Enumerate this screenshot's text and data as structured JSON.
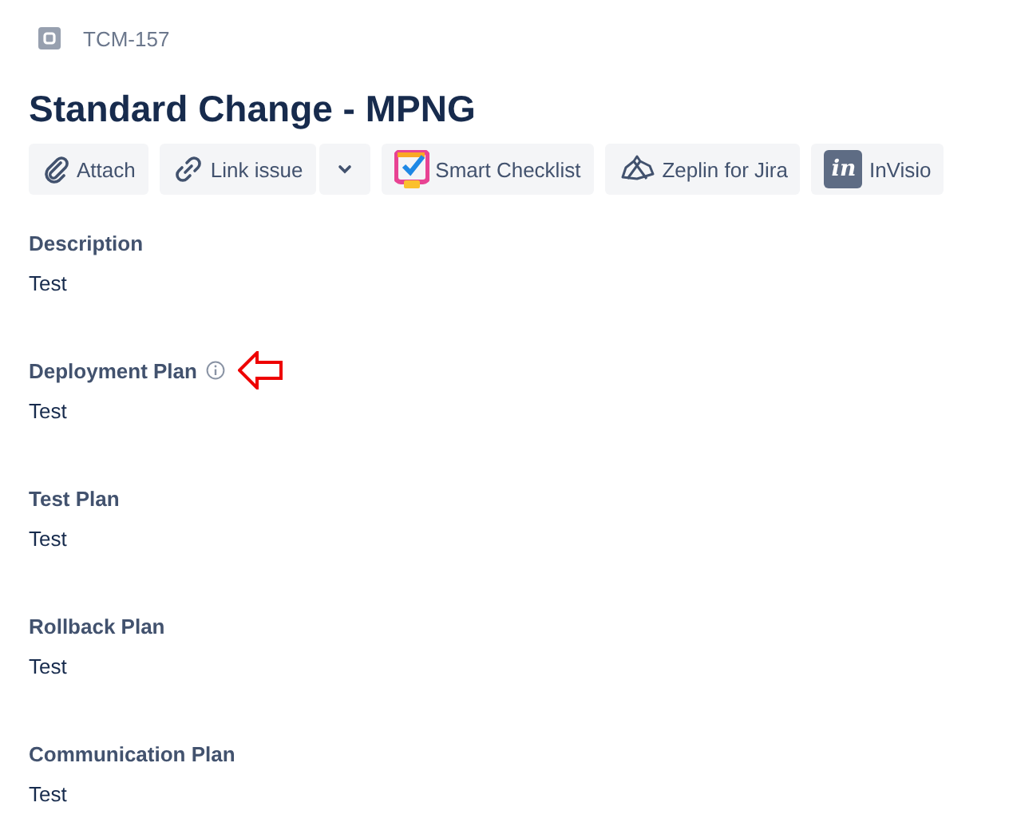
{
  "issue_key": "TCM-157",
  "title": "Standard Change - MPNG",
  "toolbar": [
    {
      "kind": "attach",
      "label": "Attach"
    },
    {
      "kind": "link",
      "label": "Link issue"
    },
    {
      "kind": "checklist",
      "label": "Smart Checklist"
    },
    {
      "kind": "zeplin",
      "label": "Zeplin for Jira"
    },
    {
      "kind": "invision",
      "label": "InVisio",
      "logo": "in"
    }
  ],
  "fields": [
    {
      "label": "Description",
      "value": "Test",
      "info": false
    },
    {
      "label": "Deployment Plan",
      "value": "Test",
      "info": true
    },
    {
      "label": "Test Plan",
      "value": "Test",
      "info": false
    },
    {
      "label": "Rollback Plan",
      "value": "Test",
      "info": false
    },
    {
      "label": "Communication Plan",
      "value": "Test",
      "info": false
    }
  ]
}
